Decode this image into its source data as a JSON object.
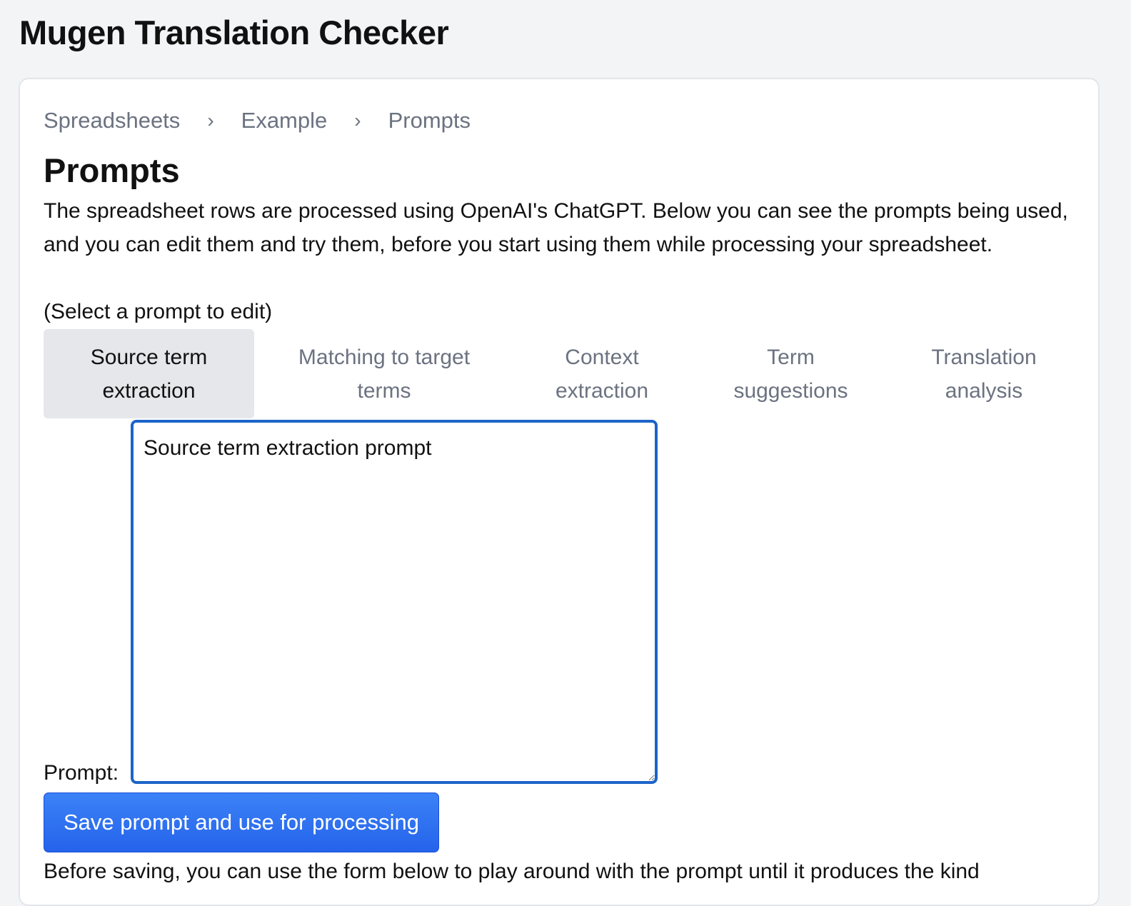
{
  "app": {
    "title": "Mugen Translation Checker"
  },
  "breadcrumb": {
    "items": [
      "Spreadsheets",
      "Example",
      "Prompts"
    ],
    "separator": "›"
  },
  "page": {
    "title": "Prompts",
    "intro": "The spreadsheet rows are processed using OpenAI's ChatGPT. Below you can see the prompts being used, and you can edit them and try them, before you start using them while processing your spreadsheet.",
    "select_hint": "(Select a prompt to edit)"
  },
  "tabs": [
    {
      "label": "Source term extraction",
      "active": true
    },
    {
      "label": "Matching to target terms",
      "active": false
    },
    {
      "label": "Context extraction",
      "active": false
    },
    {
      "label": "Term suggestions",
      "active": false
    },
    {
      "label": "Translation analysis",
      "active": false
    }
  ],
  "prompt": {
    "label": "Prompt:",
    "value": "Source term extraction prompt"
  },
  "save_button": {
    "label": "Save prompt and use for processing"
  },
  "footnote": {
    "text": "Before saving, you can use the form below to play around with the prompt until it produces the kind"
  },
  "colors": {
    "page_background": "#f3f4f6",
    "card_background": "#ffffff",
    "accent": "#2563eb",
    "textarea_focus_border": "#1c64c8",
    "active_tab_background": "#e5e7eb",
    "muted_text": "#6b7280"
  }
}
